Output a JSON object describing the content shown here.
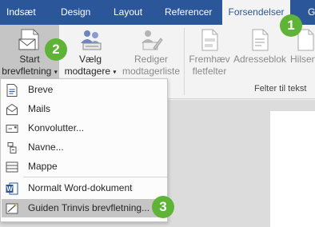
{
  "tabs": [
    "Indsæt",
    "Design",
    "Layout",
    "Referencer",
    "Forsendelser",
    "G"
  ],
  "active_tab": "Forsendelser",
  "ribbon": {
    "start_merge": {
      "line1": "Start",
      "line2": "brevfletning"
    },
    "select_recipients": {
      "line1": "Vælg",
      "line2": "modtagere"
    },
    "edit_list": {
      "line1": "Rediger",
      "line2": "modtagerliste"
    },
    "highlight_fields": {
      "line1": "Fremhæv",
      "line2": "fletfelter"
    },
    "address_block": {
      "line1": "Adresseblok"
    },
    "greeting": {
      "line1": "Hilsen"
    },
    "group_label": "Felter til tekst"
  },
  "menu": {
    "items": [
      {
        "label": "Breve",
        "icon": "letter-icon"
      },
      {
        "label": "Mails",
        "icon": "email-icon"
      },
      {
        "label": "Konvolutter...",
        "icon": "envelope-icon"
      },
      {
        "label": "Navne...",
        "icon": "labels-icon"
      },
      {
        "label": "Mappe",
        "icon": "directory-icon"
      },
      {
        "label": "Normalt Word-dokument",
        "icon": "word-icon"
      },
      {
        "label": "Guiden Trinvis brevfletning...",
        "icon": "wizard-icon"
      }
    ]
  },
  "badges": [
    "1",
    "2",
    "3"
  ],
  "colors": {
    "tabbar": "#2b579a",
    "badge": "#5fb336",
    "highlight": "#c5c5c5",
    "word_blue": "#2b579a"
  }
}
